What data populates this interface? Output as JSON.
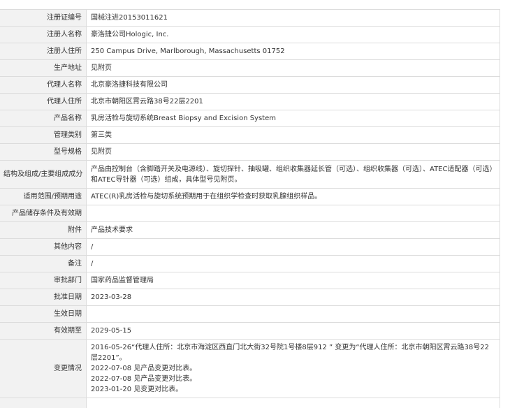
{
  "rows": [
    {
      "label": "注册证编号",
      "value": "国械注进20153011621"
    },
    {
      "label": "注册人名称",
      "value": "豪洛捷公司Hologic, Inc."
    },
    {
      "label": "注册人住所",
      "value": "250 Campus Drive, Marlborough, Massachusetts 01752"
    },
    {
      "label": "生产地址",
      "value": "见附页"
    },
    {
      "label": "代理人名称",
      "value": "北京豪洛捷科技有限公司"
    },
    {
      "label": "代理人住所",
      "value": "北京市朝阳区霄云路38号22层2201"
    },
    {
      "label": "产品名称",
      "value": "乳房活检与旋切系统Breast Biopsy and Excision System"
    },
    {
      "label": "管理类别",
      "value": "第三类"
    },
    {
      "label": "型号规格",
      "value": "见附页"
    },
    {
      "label": "结构及组成/主要组成成分",
      "value": "产品由控制台（含脚踏开关及电源线）、旋切探针、抽吸罐、组织收集器延长管（可选）、组织收集器（可选）、ATEC适配器（可选）和ATEC导针器（可选）组成，具体型号见附页。"
    },
    {
      "label": "适用范围/预期用途",
      "value": "ATEC(R)乳房活检与旋切系统预期用于在组织学检查时获取乳腺组织样品。"
    },
    {
      "label": "产品储存条件及有效期",
      "value": ""
    },
    {
      "label": "附件",
      "value": "产品技术要求"
    },
    {
      "label": "其他内容",
      "value": "/"
    },
    {
      "label": "备注",
      "value": "/"
    },
    {
      "label": "审批部门",
      "value": "国家药品监督管理局"
    },
    {
      "label": "批准日期",
      "value": "2023-03-28"
    },
    {
      "label": "生效日期",
      "value": ""
    },
    {
      "label": "有效期至",
      "value": "2029-05-15"
    }
  ],
  "change": {
    "label": "变更情况",
    "lines": [
      "2016-05-26“代理人住所：北京市海淀区西直门北大街32号院1号楼8层912 ” 变更为“代理人住所：北京市朝阳区霄云路38号22层2201”。",
      "2022-07-08 见产品变更对比表。",
      "2022-07-08 见产品变更对比表。",
      "2023-01-20 见变更对比表。"
    ]
  },
  "trailing_row": {
    "label": "",
    "value": ""
  }
}
